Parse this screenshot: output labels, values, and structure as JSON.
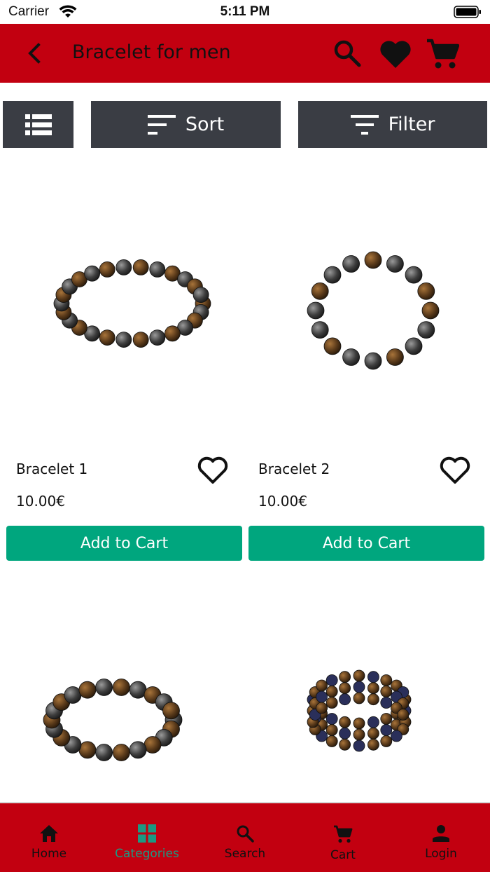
{
  "status_bar": {
    "carrier": "Carrier",
    "time": "5:11 PM"
  },
  "app_bar": {
    "title": "Bracelet for men"
  },
  "toolbar": {
    "sort_label": "Sort",
    "filter_label": "Filter"
  },
  "products": [
    {
      "name": "Bracelet 1",
      "price": "10.00€",
      "button": "Add to Cart"
    },
    {
      "name": "Bracelet 2",
      "price": "10.00€",
      "button": "Add to Cart"
    }
  ],
  "bottom_nav": {
    "items": [
      {
        "label": "Home",
        "icon": "home-icon"
      },
      {
        "label": "Categories",
        "icon": "grid-icon",
        "active": true
      },
      {
        "label": "Search",
        "icon": "search-icon"
      },
      {
        "label": "Cart",
        "icon": "cart-icon"
      },
      {
        "label": "Login",
        "icon": "person-icon"
      }
    ]
  },
  "colors": {
    "brand_red": "#c20010",
    "toolbar_gray": "#3a3d44",
    "accent_green": "#00a67e",
    "active_teal": "#1b9a83"
  }
}
